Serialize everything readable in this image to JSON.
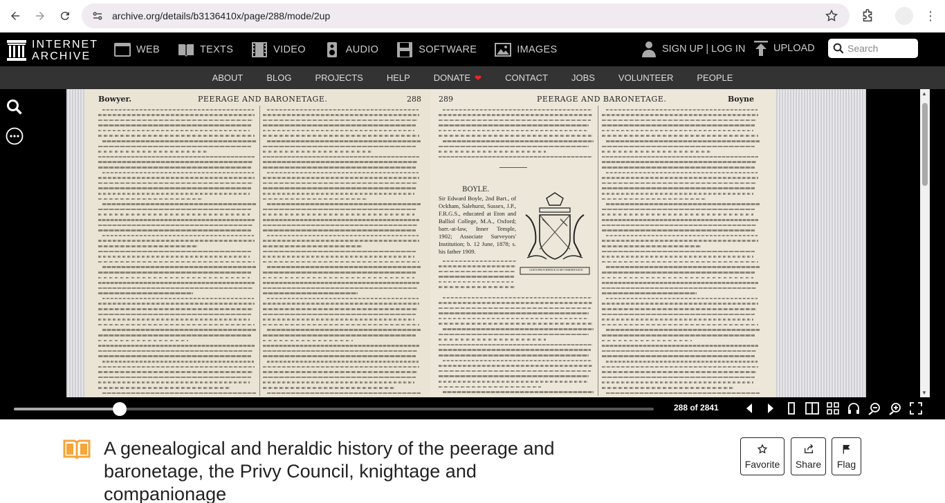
{
  "browser": {
    "url": "archive.org/details/b3136410x/page/288/mode/2up"
  },
  "ia_header": {
    "logo_line1": "INTERNET",
    "logo_line2": "ARCHIVE",
    "media": [
      {
        "label": "WEB",
        "icon": "web-icon"
      },
      {
        "label": "TEXTS",
        "icon": "texts-icon"
      },
      {
        "label": "VIDEO",
        "icon": "video-icon"
      },
      {
        "label": "AUDIO",
        "icon": "audio-icon"
      },
      {
        "label": "SOFTWARE",
        "icon": "software-icon"
      },
      {
        "label": "IMAGES",
        "icon": "images-icon"
      }
    ],
    "signup_login": "SIGN UP | LOG IN",
    "upload": "UPLOAD",
    "search_placeholder": "Search"
  },
  "sub_nav": [
    "ABOUT",
    "BLOG",
    "PROJECTS",
    "HELP",
    "DONATE",
    "CONTACT",
    "JOBS",
    "VOLUNTEER",
    "PEOPLE"
  ],
  "book": {
    "left_page": {
      "header_left": "Bowyer.",
      "header_center": "PEERAGE AND BARONETAGE.",
      "header_right": "288"
    },
    "right_page": {
      "header_left": "289",
      "header_center": "PEERAGE AND BARONETAGE.",
      "header_right": "Boyne",
      "boyle_heading": "BOYLE.",
      "crest_motto": "GOD'S PROVIDENCE IS MY INHERITANCE",
      "boyle_para": "Sir Edward Boyle, 2nd Bart., of Ockham, Salehurst, Sussex, J.P., F.R.G.S., educated at Eton and Balliol College, M.A., Oxford; barr.-at-law, Inner Temple, 1902; Associate Surveyors' Institution; b. 12 June, 1878; s. his father 1909."
    }
  },
  "reader_nav": {
    "page_count": "288 of 2841",
    "progress": 0.165
  },
  "item": {
    "title": "A genealogical and heraldic history of the peerage and baronetage, the Privy Council, knightage and companionage",
    "actions": [
      {
        "label": "Favorite",
        "icon": "star-icon"
      },
      {
        "label": "Share",
        "icon": "share-icon"
      },
      {
        "label": "Flag",
        "icon": "flag-icon"
      }
    ]
  }
}
